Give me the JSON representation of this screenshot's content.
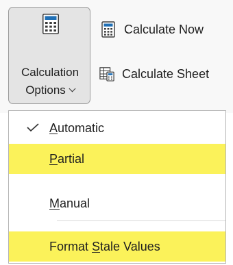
{
  "ribbon": {
    "calc_options": {
      "line1": "Calculation",
      "line2": "Options",
      "icon": "calculator-icon"
    },
    "calculate_now": {
      "label": "Calculate Now",
      "icon": "calculator-small-icon"
    },
    "calculate_sheet": {
      "label": "Calculate Sheet",
      "icon": "calculate-sheet-icon"
    }
  },
  "menu": {
    "items": [
      {
        "pre": "",
        "acc": "A",
        "post": "utomatic",
        "checked": true,
        "highlighted": false
      },
      {
        "pre": "",
        "acc": "P",
        "post": "artial",
        "checked": false,
        "highlighted": true
      },
      {
        "pre": "",
        "acc": "M",
        "post": "anual",
        "checked": false,
        "highlighted": false
      },
      {
        "pre": "Format ",
        "acc": "S",
        "post": "tale Values",
        "checked": false,
        "highlighted": true
      }
    ]
  },
  "colors": {
    "highlight": "#fbf25a",
    "ribbon_bg": "#f8f8f8",
    "pressed_button": "#e4e4e4",
    "calc_blue": "#1f6fb5"
  }
}
